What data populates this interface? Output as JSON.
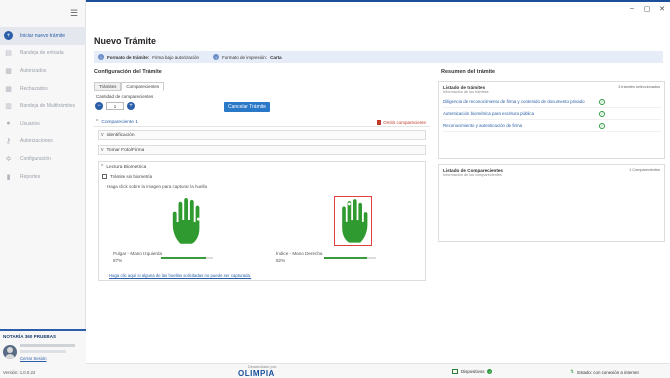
{
  "window": {
    "minimize": "–",
    "maximize": "▢",
    "close": "✕"
  },
  "sidebar": {
    "hamburger": "☰",
    "items": [
      {
        "label": "Iniciar nuevo trámite",
        "icon": "plus-icon",
        "glyph": "+",
        "active": true
      },
      {
        "label": "Bandeja de entrada",
        "icon": "inbox-icon",
        "glyph": "▤",
        "active": false
      },
      {
        "label": "Autorizados",
        "icon": "document-check-icon",
        "glyph": "▦",
        "active": false
      },
      {
        "label": "Rechazados",
        "icon": "document-x-icon",
        "glyph": "▦",
        "active": false
      },
      {
        "label": "Bandeja de Multitrámites",
        "icon": "multi-inbox-icon",
        "glyph": "▥",
        "active": false
      },
      {
        "label": "Usuarios",
        "icon": "user-icon",
        "glyph": "●",
        "active": false
      },
      {
        "label": "Autorizaciones",
        "icon": "key-icon",
        "glyph": "⚷",
        "active": false
      },
      {
        "label": "Configuración",
        "icon": "gear-icon",
        "glyph": "✲",
        "active": false
      },
      {
        "label": "Reportes",
        "icon": "chart-icon",
        "glyph": "▮",
        "active": false
      }
    ],
    "notaria": "NOTARÍA 360 PRUEBAS",
    "logout": "Cerrar Sesión",
    "version": "Versión: 1.0.0.22"
  },
  "main": {
    "title": "Nuevo Trámite",
    "info": {
      "formato_tramite_label": "Formato de trámite:",
      "formato_tramite_value": "Firma bajo autorización",
      "formato_impresion_label": "Formato de impresión:",
      "formato_impresion_value": "Carta"
    },
    "config_title": "Configuración del Trámite",
    "tabs": [
      "Trámites",
      "Comparecientes"
    ],
    "active_tab": "Comparecientes",
    "cantidad_label": "Cantidad de comparecientes",
    "cantidad_value": "1",
    "cancel_button": "Cancelar Trámite",
    "compareciente": "Compareciente 1",
    "omit": "Omitir compareciente",
    "sections": [
      "Identificación",
      "Tomar Foto/Firma"
    ],
    "bio_title": "Lectura Biometrica",
    "bio_checkbox": "Trámite sin biometría",
    "bio_hint": "Haga click sobre la imagen para capturar la huella",
    "fingers": [
      {
        "label": "Pulgar - Mano Izquierda",
        "pct_label": "87%",
        "value": 0.87,
        "selected": false
      },
      {
        "label": "Índice - Mano Derecha",
        "pct_label": "82%",
        "value": 0.82,
        "selected": true
      }
    ],
    "help_link": "Haga clic aquí si alguna de las huellas solicitadas no puede ser capturada."
  },
  "summary": {
    "title": "Resumen del trámite",
    "tramites": {
      "title": "Listado de trámites",
      "subtitle": "Información de los trámites",
      "count": "3 trámites seleccionados",
      "items": [
        "Diligencia de reconocimiento de firma y contenido de documento privado",
        "Autenticación biométrica para escritura pública",
        "Reconocimiento y autenticación de firma"
      ]
    },
    "comparecientes": {
      "title": "Listado de Comparecientes",
      "subtitle": "Información de los comparecientes",
      "count": "1 Comparecientes"
    }
  },
  "footer": {
    "powered": "Desarrollado por:",
    "brand": "OLIMPIA",
    "dispositivos": "Dispositivos",
    "estado": "Estado: con conexión a internet"
  },
  "colors": {
    "accent": "#2a5ea8",
    "success": "#2e9a3e",
    "danger": "#c0392b",
    "hand": "#2f9a2f"
  }
}
